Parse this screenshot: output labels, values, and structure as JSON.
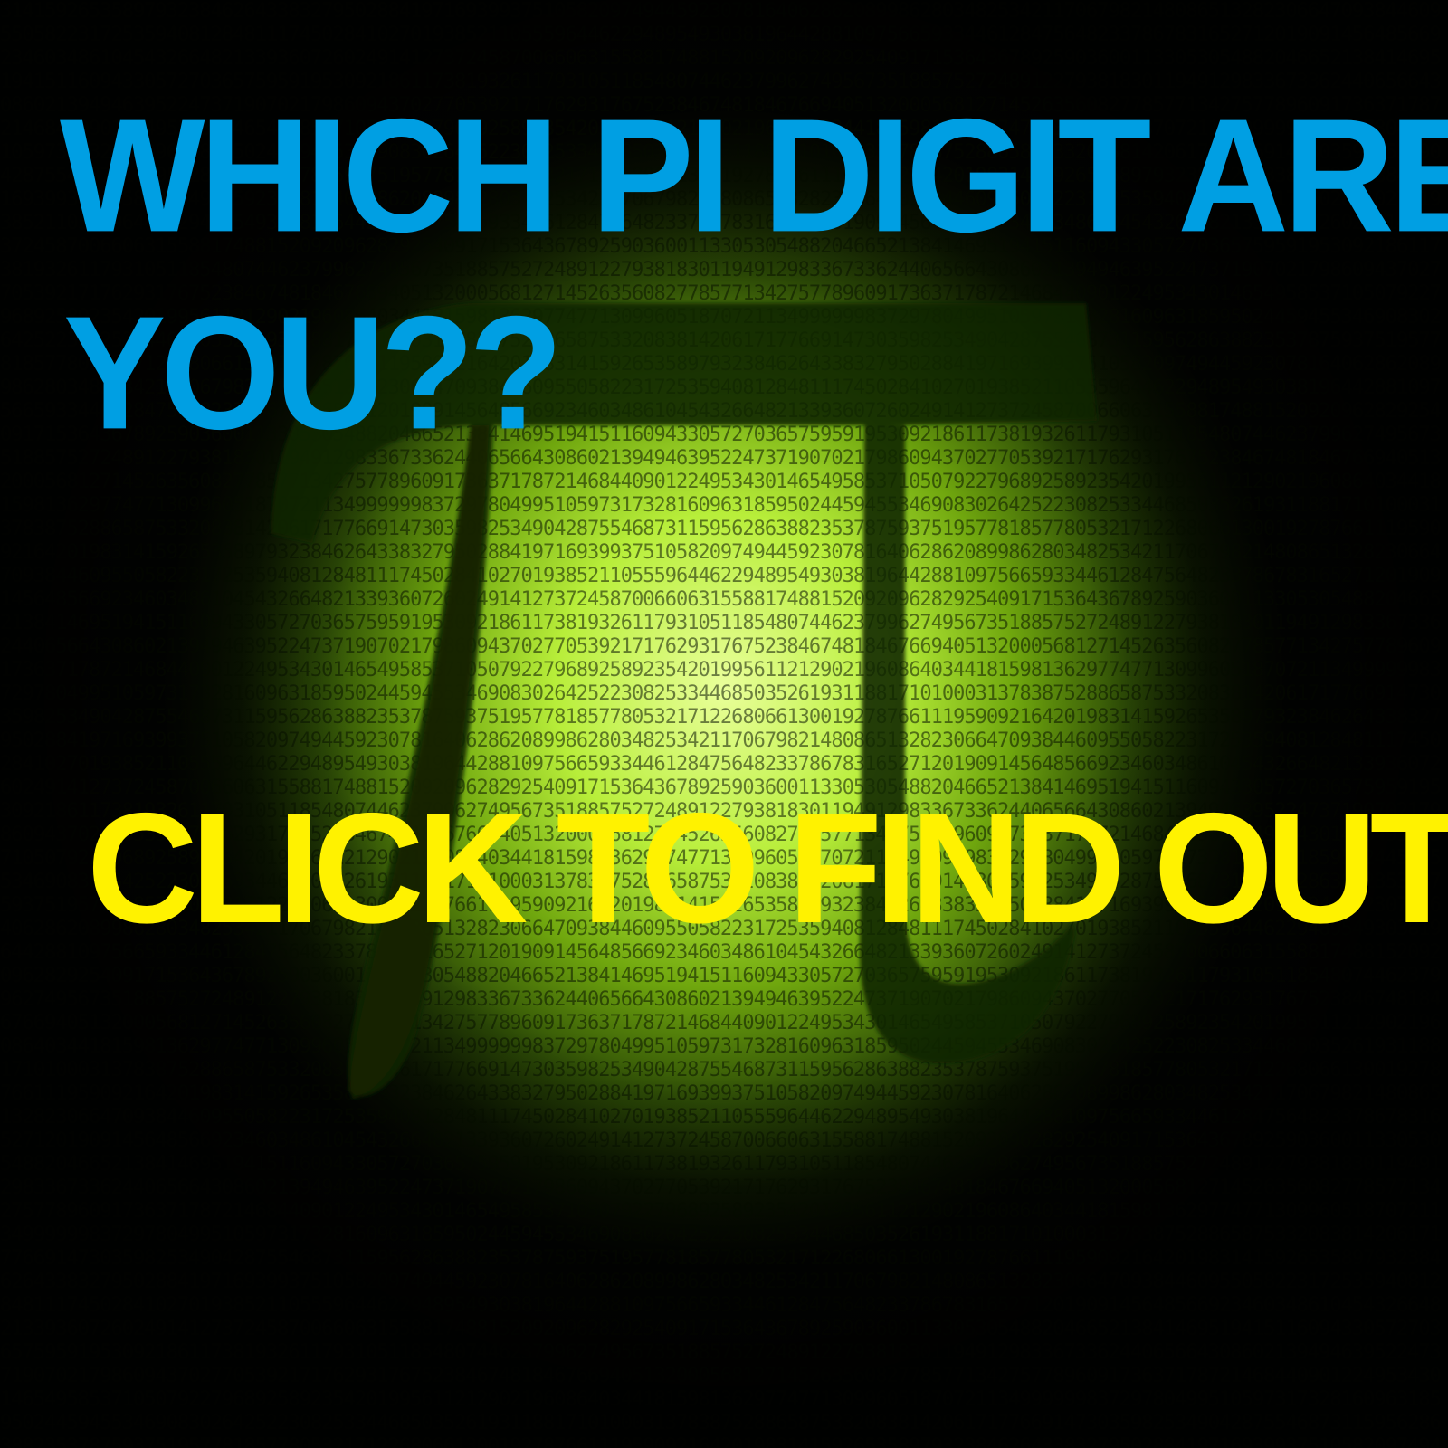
{
  "title": {
    "line1": "WHICH PI DIGIT ARE",
    "line2": "YOU??"
  },
  "cta": {
    "label": "CLICK TO FIND OUT"
  },
  "pi_symbol": {
    "glyph": "π"
  },
  "background_digits": "3141592653589793238462643383279502884197169399375105820974944592307816406286208998628034825342117067982148086513282306647093844609550582231725359408128481117450284102701938521105559644622948954930381964428810975665933446128475648233786783165271201909145648566923460348610454326648213393607260249141273724587006606315588174881520920962829254091715364367892590360011330530548820466521384146951941511609433057270365759591953092186117381932611793105118548074462379962749567351885752724891227938183011949129833673362440656643086021394946395224737190702179860943702770539217176293176752384674818467669405132000568127145263560827785771342757789609173637178721468440901224953430146549585371050792279689258923542019956112129021960864034418159813629774771309960518707211349999998372978049951059731732816096318595024459455346908302642522308253344685035261931188171010003137838752886587533208381420617177669147303598253490428755468731159562863882353787593751957781857780532171226806613001927876611195909216420198"
}
